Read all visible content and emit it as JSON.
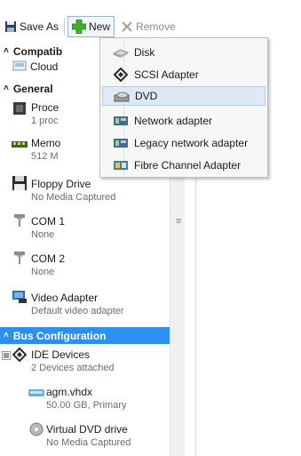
{
  "toolbar": {
    "save_as_label": "Save As",
    "new_label": "New",
    "remove_label": "Remove"
  },
  "tree": {
    "compatibility": {
      "label": "Compatib",
      "item": "Cloud"
    },
    "general": {
      "label": "General",
      "items": [
        {
          "title": "Proce",
          "sub": "1 proc"
        },
        {
          "title": "Memo",
          "sub": "512 M"
        },
        {
          "title": "Floppy Drive",
          "sub": "No Media Captured"
        },
        {
          "title": "COM 1",
          "sub": "None"
        },
        {
          "title": "COM 2",
          "sub": "None"
        },
        {
          "title": "Video Adapter",
          "sub": "Default video adapter"
        }
      ]
    },
    "bus": {
      "label": "Bus Configuration",
      "ide": {
        "title": "IDE Devices",
        "sub": "2 Devices attached"
      },
      "vhd": {
        "title": "agm.vhdx",
        "sub": "50.00 GB, Primary"
      },
      "dvd": {
        "title": "Virtual DVD drive",
        "sub": "No Media Captured"
      }
    }
  },
  "menu": {
    "items": [
      {
        "label": "Disk",
        "icon": "disk-icon"
      },
      {
        "label": "SCSI Adapter",
        "icon": "scsi-adapter-icon"
      },
      {
        "label": "DVD",
        "icon": "dvd-icon"
      },
      {
        "label": "Network adapter",
        "icon": "network-adapter-icon"
      },
      {
        "label": "Legacy network adapter",
        "icon": "legacy-network-adapter-icon"
      },
      {
        "label": "Fibre Channel Adapter",
        "icon": "fibre-channel-icon"
      }
    ]
  },
  "colors": {
    "selection": "#2d8ff0",
    "new_icon": "#3fae29"
  }
}
